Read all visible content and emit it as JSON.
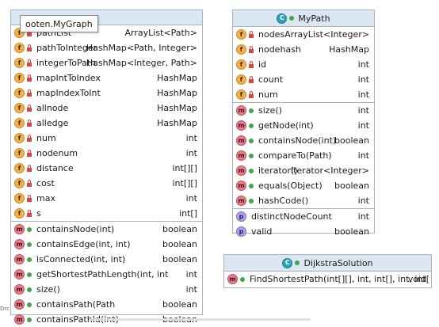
{
  "mygraph": {
    "tooltip": "ooten.MyGraph",
    "fields": [
      {
        "icon": "f",
        "name": "pathList",
        "type": "ArrayList<Path>"
      },
      {
        "icon": "f",
        "name": "pathToInteger",
        "type": "HashMap<Path, Integer>"
      },
      {
        "icon": "f",
        "name": "integerToPath",
        "type": "HashMap<Integer, Path>"
      },
      {
        "icon": "f",
        "name": "mapIntToIndex",
        "type": "HashMap"
      },
      {
        "icon": "f",
        "name": "mapIndexToInt",
        "type": "HashMap"
      },
      {
        "icon": "f",
        "name": "allnode",
        "type": "HashMap"
      },
      {
        "icon": "f",
        "name": "alledge",
        "type": "HashMap"
      },
      {
        "icon": "f",
        "name": "num",
        "type": "int"
      },
      {
        "icon": "f",
        "name": "nodenum",
        "type": "int"
      },
      {
        "icon": "f",
        "name": "distance",
        "type": "int[][]"
      },
      {
        "icon": "f",
        "name": "cost",
        "type": "int[][]"
      },
      {
        "icon": "f",
        "name": "max",
        "type": "int"
      },
      {
        "icon": "f",
        "name": "s",
        "type": "int[]"
      }
    ],
    "methods": [
      {
        "icon": "m",
        "name": "containsNode(int)",
        "type": "boolean"
      },
      {
        "icon": "m",
        "name": "containsEdge(int, int)",
        "type": "boolean"
      },
      {
        "icon": "m",
        "name": "isConnected(int, int)",
        "type": "boolean"
      },
      {
        "icon": "m",
        "name": "getShortestPathLength(int, int",
        "type": "int"
      },
      {
        "icon": "m",
        "name": "size()",
        "type": "int"
      },
      {
        "icon": "m",
        "name": "containsPath(Path",
        "type": "boolean"
      },
      {
        "icon": "m",
        "name": "containsPathId(int)",
        "type": "boolean"
      }
    ]
  },
  "mypath": {
    "title": "MyPath",
    "fields": [
      {
        "icon": "f",
        "name": "nodes",
        "type": "ArrayList<Integer>"
      },
      {
        "icon": "f",
        "name": "nodehash",
        "type": "HashMap"
      },
      {
        "icon": "f",
        "name": "id",
        "type": "int"
      },
      {
        "icon": "f",
        "name": "count",
        "type": "int"
      },
      {
        "icon": "f",
        "name": "num",
        "type": "int"
      }
    ],
    "methods": [
      {
        "icon": "m",
        "name": "size()",
        "type": "int"
      },
      {
        "icon": "m",
        "name": "getNode(int)",
        "type": "int"
      },
      {
        "icon": "m",
        "name": "containsNode(int)",
        "type": "boolean"
      },
      {
        "icon": "m",
        "name": "compareTo(Path)",
        "type": "int"
      },
      {
        "icon": "m",
        "name": "iterator()",
        "type": "Iterator<Integer>"
      },
      {
        "icon": "m",
        "name": "equals(Object)",
        "type": "boolean"
      },
      {
        "icon": "m",
        "name": "hashCode()",
        "type": "int"
      }
    ],
    "properties": [
      {
        "icon": "p",
        "name": "distinctNodeCount",
        "type": "int"
      },
      {
        "icon": "p",
        "name": "valid",
        "type": "boolean"
      }
    ]
  },
  "dijkstra": {
    "title": "DijkstraSolution",
    "methods": [
      {
        "icon": "m",
        "name": "FindShortestPath(int[][], int, int[], int, int[",
        "type": "void"
      }
    ]
  },
  "colors": {
    "header_bg": "#dbe6f3",
    "border": "#a9b3c0",
    "field_icon": "#f4b14a",
    "method_icon": "#e77f8d",
    "property_icon": "#b0a4e8",
    "class_icon": "#2ea3b6"
  }
}
